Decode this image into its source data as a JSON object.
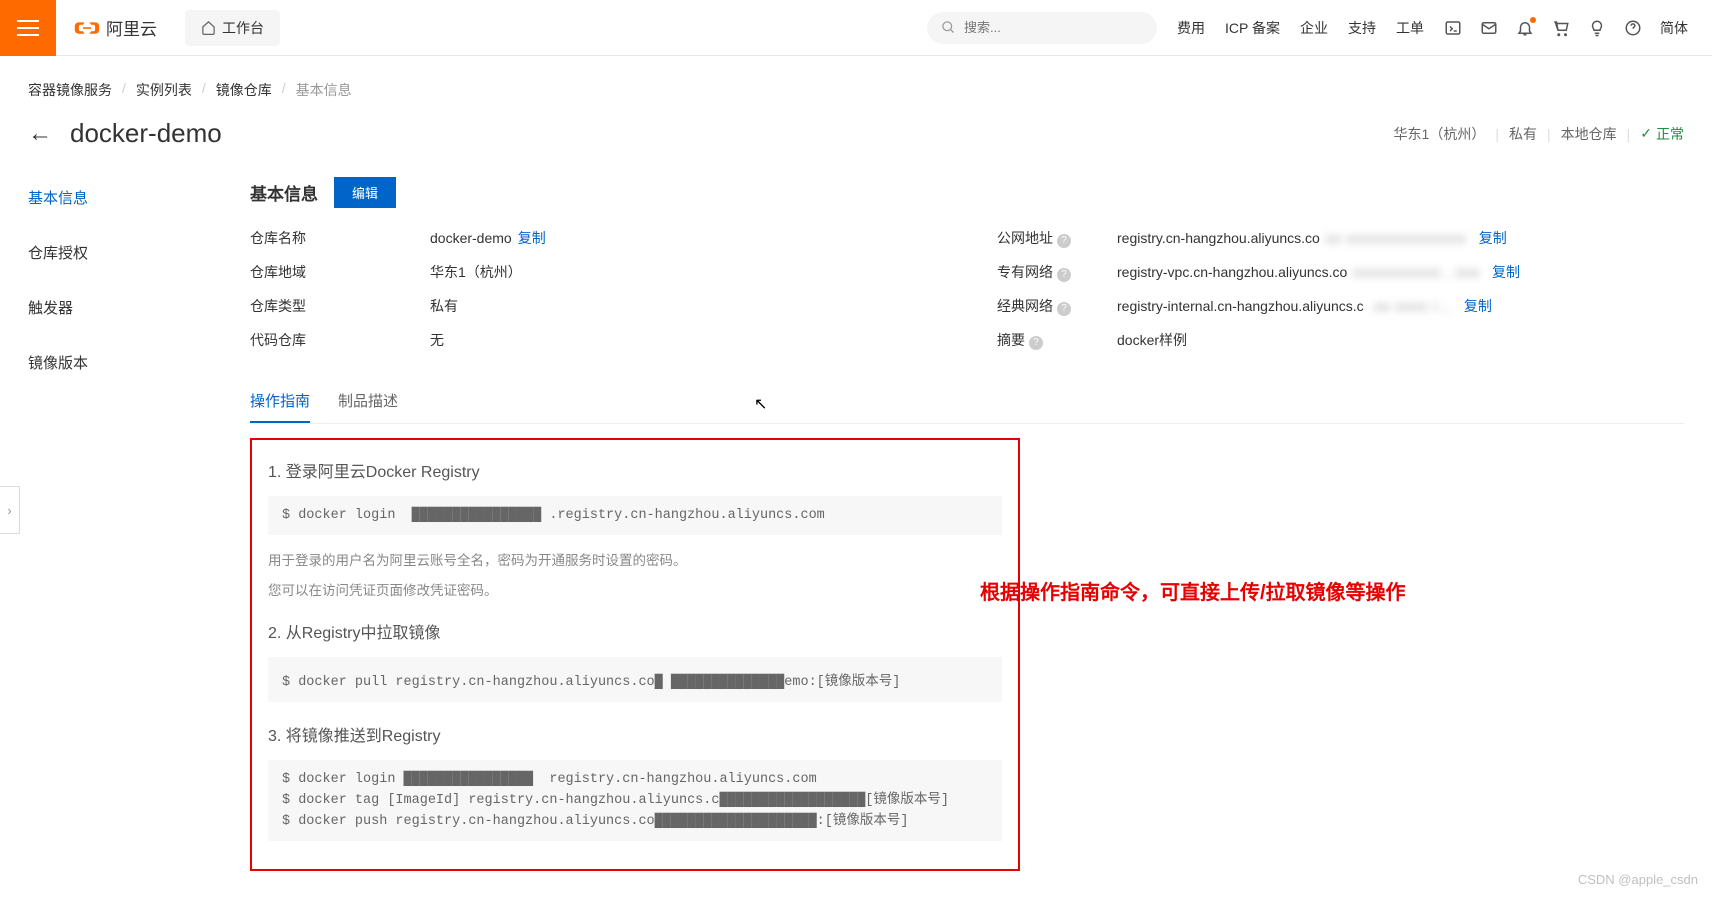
{
  "topbar": {
    "brand": "阿里云",
    "workbench": "工作台",
    "search_placeholder": "搜索...",
    "links": [
      "费用",
      "ICP 备案",
      "企业",
      "支持",
      "工单"
    ],
    "lang": "简体"
  },
  "breadcrumb": {
    "items": [
      "容器镜像服务",
      "实例列表",
      "镜像仓库"
    ],
    "current": "基本信息"
  },
  "title": {
    "name": "docker-demo",
    "region": "华东1（杭州）",
    "visibility": "私有",
    "repo_type": "本地仓库",
    "status": "正常"
  },
  "sidenav": {
    "items": [
      "基本信息",
      "仓库授权",
      "触发器",
      "镜像版本"
    ],
    "active": 0
  },
  "panel": {
    "title": "基本信息",
    "edit_btn": "编辑",
    "left": [
      {
        "label": "仓库名称",
        "value": "docker-demo",
        "copy": "复制"
      },
      {
        "label": "仓库地域",
        "value": "华东1（杭州）"
      },
      {
        "label": "仓库类型",
        "value": "私有"
      },
      {
        "label": "代码仓库",
        "value": "无"
      }
    ],
    "right": [
      {
        "label": "公网地址",
        "q": true,
        "addr": "registry.cn-hangzhou.aliyuncs.co",
        "mask": "xx xxxxxxxxxxxxxxx",
        "copy": "复制"
      },
      {
        "label": "专有网络",
        "q": true,
        "addr": "registry-vpc.cn-hangzhou.aliyuncs.co",
        "mask": "xxxxxxxxxxx , xxx",
        "copy": "复制"
      },
      {
        "label": "经典网络",
        "q": true,
        "addr": "registry-internal.cn-hangzhou.aliyuncs.c",
        "mask": ".xx xxxx  /...",
        "copy": "复制"
      },
      {
        "label": "摘要",
        "q": true,
        "value": "docker样例"
      }
    ]
  },
  "tabs": {
    "items": [
      "操作指南",
      "制品描述"
    ],
    "active": 0
  },
  "guide": {
    "sections": [
      {
        "title": "1. 登录阿里云Docker Registry",
        "code": "$ docker login  ████████████████ .registry.cn-hangzhou.aliyuncs.com",
        "notes": [
          "用于登录的用户名为阿里云账号全名，密码为开通服务时设置的密码。",
          "您可以在访问凭证页面修改凭证密码。"
        ]
      },
      {
        "title": "2. 从Registry中拉取镜像",
        "code": "$ docker pull registry.cn-hangzhou.aliyuncs.co█ ██████████████emo:[镜像版本号]"
      },
      {
        "title": "3. 将镜像推送到Registry",
        "code": "$ docker login ████████████████  registry.cn-hangzhou.aliyuncs.com\n$ docker tag [ImageId] registry.cn-hangzhou.aliyuncs.c██████████████████[镜像版本号]\n$ docker push registry.cn-hangzhou.aliyuncs.co████████████████████:[镜像版本号]"
      }
    ]
  },
  "annotation": "根据操作指南命令，可直接上传/拉取镜像等操作",
  "watermark": "CSDN @apple_csdn"
}
